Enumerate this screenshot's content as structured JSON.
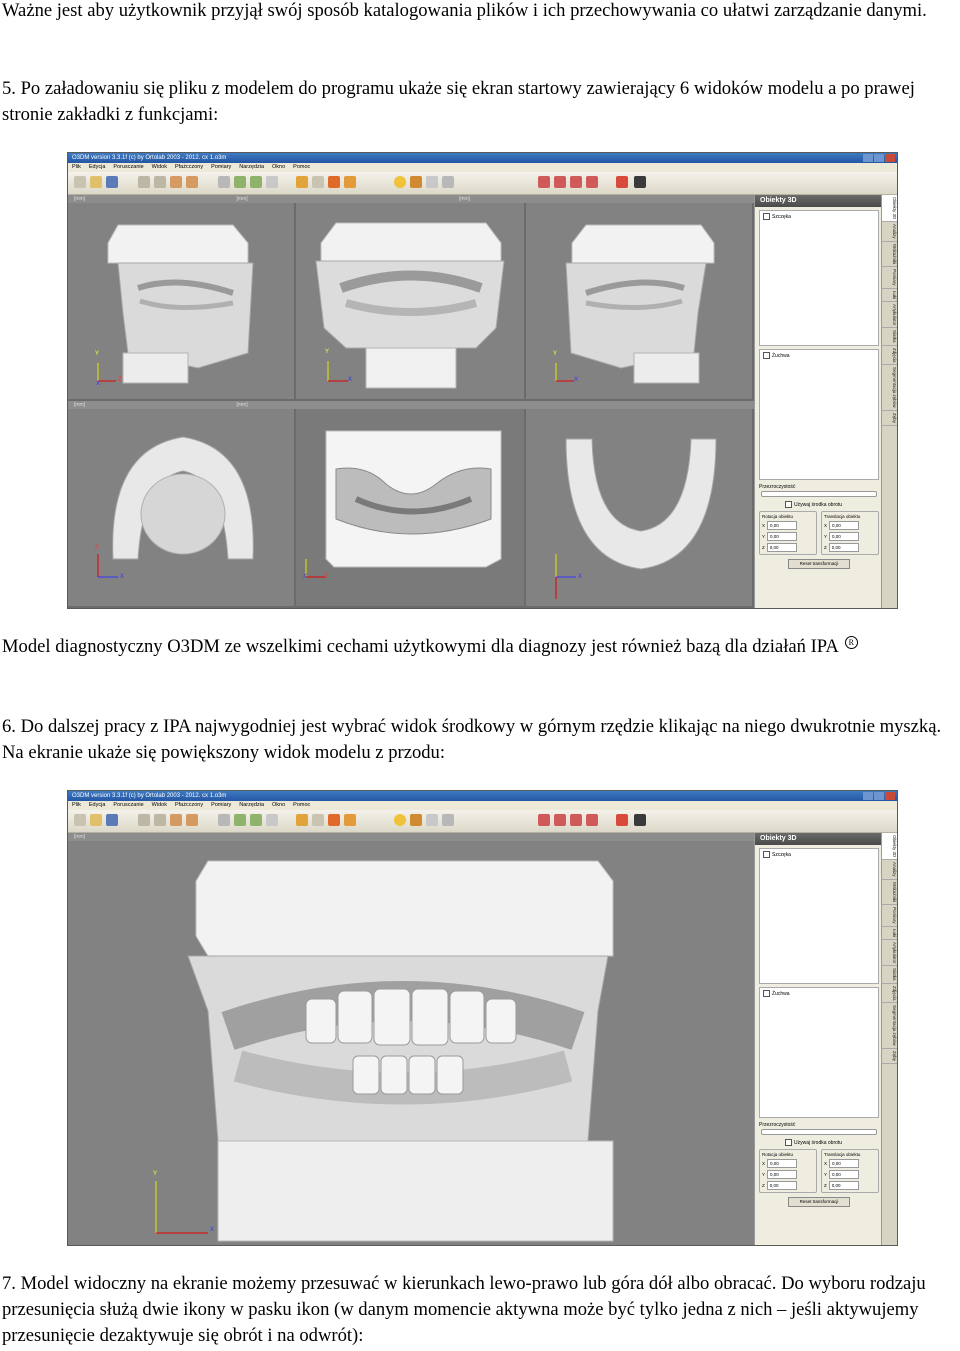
{
  "paragraphs": {
    "p1": "Ważne jest aby użytkownik przyjął swój sposób katalogowania plików i ich przechowywania co ułatwi zarządzanie danymi.",
    "p2": "5. Po załadowaniu się pliku z modelem do programu ukaże się ekran startowy zawierający 6 widoków modelu a po prawej stronie zakładki z funkcjami:",
    "p3": "Model diagnostyczny O3DM ze wszelkimi cechami użytkowymi dla diagnozy jest również bazą dla działań IPA",
    "p3_mark": "R",
    "p4": "6. Do dalszej pracy z IPA najwygodniej jest wybrać widok środkowy w górnym rzędzie klikając na niego dwukrotnie myszką. Na ekranie ukaże się powiększony widok modelu z przodu:",
    "p5": "7. Model widoczny na ekranie możemy przesuwać w kierunkach lewo-prawo lub góra dół albo obracać. Do wyboru rodzaju przesunięcia służą dwie ikony w pasku ikon (w danym momencie aktywna może być tylko jedna z nich – jeśli aktywujemy przesunięcie dezaktywuje się obrót i na odwrót):"
  },
  "app": {
    "title": "O3DM version 3.3.1f (c) by Ortolab 2003 - 2012. cx 1.o3m",
    "menu": [
      "Plik",
      "Edycja",
      "Porusczanie",
      "Widok",
      "Pfażcczony",
      "Pomiary",
      "Narzędzia",
      "Okno",
      "Pomoc"
    ],
    "panel_title": "Obiekty 3D",
    "obj_upper": "Szczęka",
    "obj_lower": "Żuchwa",
    "opacity_label": "Przezroczystość",
    "avg_label": "Używaj środka obrotu",
    "rot_label": "Rotacja obiektu",
    "trans_label": "Translacja obiektu",
    "num_value": "0,00",
    "reset_label": "Reset transformacji",
    "tabs": [
      "Obiekty 3D",
      "Analizy",
      "Wskaźniki",
      "Pomiary",
      "Łuki",
      "Artykulator",
      "Siatka",
      "Zdjęcia",
      "Segmentacja zębów",
      "Zęby"
    ],
    "ruler_unit": "[mm]",
    "axes": {
      "x": "X",
      "y": "Y",
      "z": "Z"
    }
  },
  "colors": {
    "viewport": "#828282",
    "panel": "#efede0",
    "titlebar": "#2c5fae",
    "model": "#e6e6e6"
  }
}
